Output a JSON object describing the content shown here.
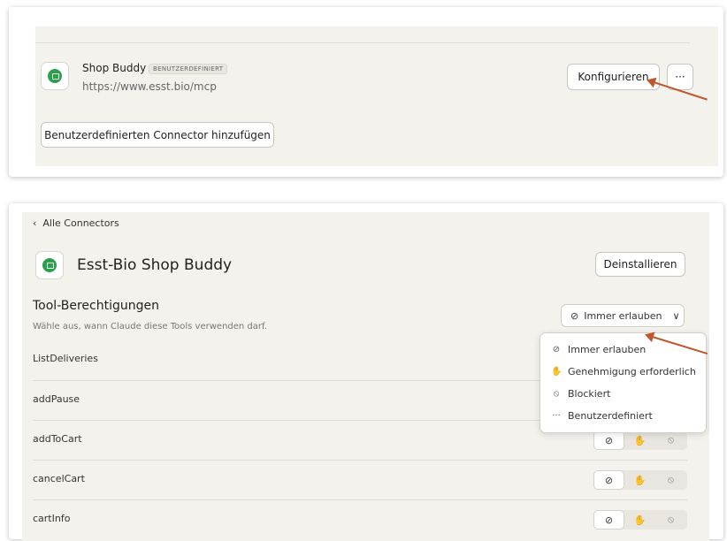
{
  "connector": {
    "name": "Shop Buddy",
    "badge": "BENUTZERDEFINIERT",
    "url": "https://www.esst.bio/mcp",
    "configure_label": "Konfigurieren",
    "more_label": "···",
    "add_custom_label": "Benutzerdefinierten Connector hinzufügen"
  },
  "detail": {
    "back_label": "Alle Connectors",
    "title": "Esst-Bio Shop Buddy",
    "uninstall_label": "Deinstallieren",
    "section_title": "Tool-Berechtigungen",
    "subtext": "Wähle aus, wann Claude diese Tools verwenden darf.",
    "dropdown_value": "Immer erlauben",
    "menu": [
      {
        "icon": "check-circle-icon",
        "label": "Immer erlauben"
      },
      {
        "icon": "hand-icon",
        "label": "Genehmigung erforderlich"
      },
      {
        "icon": "block-icon",
        "label": "Blockiert"
      },
      {
        "icon": "ellipsis-icon",
        "label": "Benutzerdefiniert"
      }
    ],
    "tools": [
      {
        "name": "ListDeliveries"
      },
      {
        "name": "addPause"
      },
      {
        "name": "addToCart"
      },
      {
        "name": "cancelCart"
      },
      {
        "name": "cartInfo"
      }
    ]
  },
  "colors": {
    "accent_arrow": "#c0572a",
    "logo_green": "#2aa14a"
  }
}
